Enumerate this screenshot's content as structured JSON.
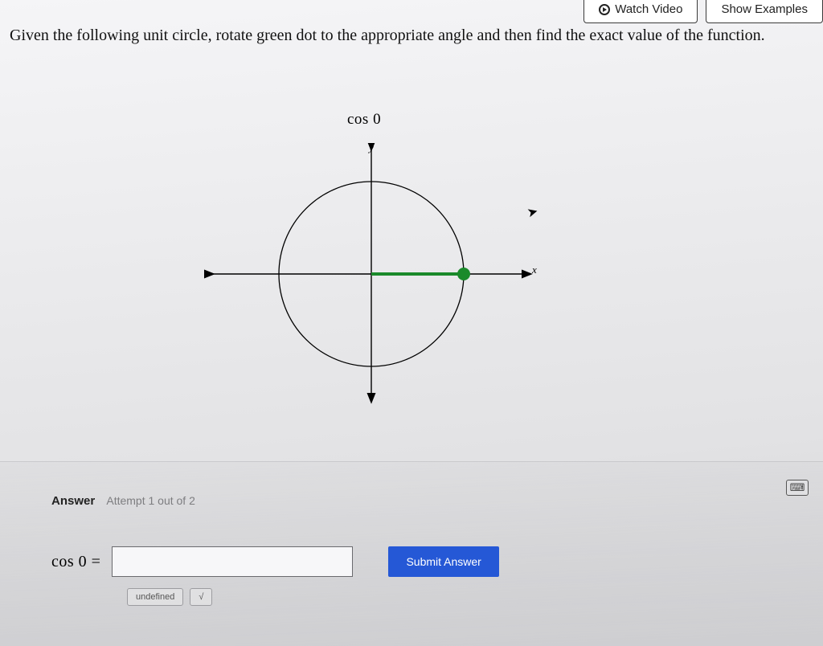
{
  "top": {
    "watch_video": "Watch Video",
    "show_examples": "Show Examples"
  },
  "prompt": "Given the following unit circle, rotate green dot to the appropriate angle and then find the exact value of the function.",
  "function_label": "cos 0",
  "axis": {
    "x": "x",
    "y": "y"
  },
  "answer": {
    "heading": "Answer",
    "attempt": "Attempt 1 out of 2",
    "lhs": "cos 0 =",
    "input_value": "",
    "submit": "Submit Answer",
    "undefined_btn": "undefined",
    "sqrt_btn": "√"
  }
}
